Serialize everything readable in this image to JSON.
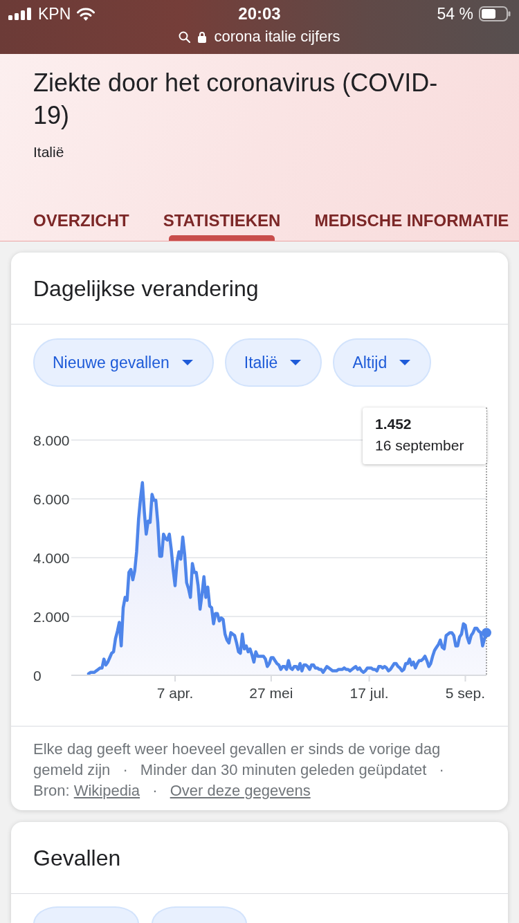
{
  "status_bar": {
    "carrier": "KPN",
    "time": "20:03",
    "battery": "54 %",
    "address": "corona italie cijfers"
  },
  "header": {
    "title": "Ziekte door het coronavirus (COVID-19)",
    "subtitle": "Italië"
  },
  "tabs": [
    {
      "label": "OVERZICHT",
      "selected": false
    },
    {
      "label": "STATISTIEKEN",
      "selected": true
    },
    {
      "label": "MEDISCHE INFORMATIE",
      "selected": false
    }
  ],
  "cards": [
    {
      "title": "Dagelijkse verandering",
      "filters": [
        {
          "label": "Nieuwe gevallen"
        },
        {
          "label": "Italië"
        },
        {
          "label": "Altijd"
        }
      ],
      "chart": {
        "tooltip": {
          "value": "1.452",
          "date": "16 september"
        },
        "chart_data": {
          "type": "area",
          "grid": true,
          "categories": [
            null,
            null,
            null,
            null,
            null,
            null,
            null,
            null,
            null,
            null,
            null,
            null,
            null,
            null,
            null,
            null,
            null,
            null,
            null,
            null,
            null,
            null,
            null,
            null,
            null,
            null,
            null,
            null,
            null,
            null,
            null,
            null,
            null,
            null,
            null,
            null,
            null,
            null,
            null,
            null,
            null,
            null,
            null,
            null,
            null,
            "7 apr.",
            null,
            null,
            null,
            null,
            null,
            null,
            null,
            null,
            null,
            null,
            null,
            null,
            null,
            null,
            null,
            null,
            null,
            null,
            null,
            null,
            null,
            null,
            null,
            null,
            null,
            null,
            null,
            null,
            null,
            null,
            null,
            null,
            null,
            null,
            null,
            null,
            null,
            null,
            null,
            null,
            null,
            null,
            null,
            null,
            null,
            null,
            null,
            null,
            null,
            "27 mei",
            null,
            null,
            null,
            null,
            null,
            null,
            null,
            null,
            null,
            null,
            null,
            null,
            null,
            null,
            null,
            null,
            null,
            null,
            null,
            null,
            null,
            null,
            null,
            null,
            null,
            null,
            null,
            null,
            null,
            null,
            null,
            null,
            null,
            null,
            null,
            null,
            null,
            null,
            null,
            null,
            null,
            null,
            null,
            null,
            null,
            null,
            null,
            null,
            null,
            null,
            "17 jul.",
            null,
            null,
            null,
            null,
            null,
            null,
            null,
            null,
            null,
            null,
            null,
            null,
            null,
            null,
            null,
            null,
            null,
            null,
            null,
            null,
            null,
            null,
            null,
            null,
            null,
            null,
            null,
            null,
            null,
            null,
            null,
            null,
            null,
            null,
            null,
            null,
            null,
            null,
            null,
            null,
            null,
            null,
            null,
            null,
            null,
            null,
            null,
            null,
            null,
            "5 sep.",
            null,
            null,
            null,
            null,
            null,
            null,
            null,
            null,
            null,
            null,
            null
          ],
          "series": [
            {
              "color": "#4e85ea",
              "values": [
                50,
                100,
                100,
                100,
                150,
                200,
                250,
                250,
                550,
                350,
                450,
                600,
                750,
                800,
                1250,
                1500,
                1800,
                1000,
                2300,
                2650,
                2550,
                3500,
                3600,
                3250,
                3550,
                4200,
                5300,
                6000,
                6550,
                5550,
                4800,
                5250,
                5200,
                6150,
                5950,
                5950,
                5200,
                4050,
                4050,
                4800,
                4650,
                4600,
                4800,
                4300,
                3600,
                3050,
                3850,
                4200,
                3950,
                4700,
                4100,
                3150,
                2950,
                2650,
                3800,
                3500,
                3500,
                3050,
                2250,
                2750,
                3350,
                2650,
                3000,
                2350,
                2300,
                1750,
                2100,
                2100,
                1850,
                1950,
                1900,
                1400,
                1200,
                1100,
                1450,
                1400,
                1350,
                1100,
                800,
                750,
                1400,
                900,
                1000,
                800,
                900,
                700,
                450,
                800,
                650,
                650,
                650,
                650,
                550,
                300,
                400,
                600,
                600,
                500,
                400,
                350,
                200,
                300,
                300,
                200,
                500,
                250,
                200,
                300,
                300,
                200,
                400,
                150,
                350,
                350,
                300,
                200,
                350,
                350,
                250,
                250,
                200,
                200,
                100,
                200,
                300,
                250,
                200,
                150,
                150,
                150,
                200,
                200,
                200,
                250,
                200,
                200,
                150,
                200,
                250,
                300,
                200,
                250,
                150,
                100,
                150,
                250,
                250,
                250,
                200,
                200,
                150,
                300,
                300,
                250,
                300,
                250,
                150,
                200,
                300,
                400,
                400,
                300,
                250,
                150,
                200,
                400,
                400,
                550,
                350,
                450,
                250,
                400,
                500,
                500,
                550,
                650,
                500,
                300,
                400,
                650,
                850,
                950,
                1050,
                1200,
                950,
                900,
                1350,
                1400,
                1450,
                1450,
                1350,
                1000,
                1000,
                1300,
                1400,
                1750,
                1700,
                1300,
                1100,
                1350,
                1450,
                1600,
                1600,
                1500,
                1450,
                1000,
                1250,
                1450
              ]
            }
          ],
          "ylim": [
            0,
            8000
          ],
          "yticks": [
            {
              "value": 0,
              "label": "0"
            },
            {
              "value": 2000,
              "label": "2.000"
            },
            {
              "value": 4000,
              "label": "4.000"
            },
            {
              "value": 6000,
              "label": "6.000"
            },
            {
              "value": 8000,
              "label": "8.000"
            }
          ]
        }
      },
      "footnote": [
        {
          "kind": "text",
          "text": "Elke dag geeft weer hoeveel gevallen er sinds de vorige dag gemeld zijn"
        },
        {
          "kind": "separator",
          "text": "·"
        },
        {
          "kind": "text",
          "text": "Minder dan 30 minuten geleden geüpdatet"
        },
        {
          "kind": "separator",
          "text": "·"
        },
        {
          "kind": "text",
          "text": "Bron:"
        },
        {
          "kind": "link",
          "text": "Wikipedia"
        },
        {
          "kind": "separator",
          "text": "·"
        },
        {
          "kind": "link",
          "text": "Over deze gegevens"
        }
      ]
    },
    {
      "title": "Gevallen"
    }
  ]
}
